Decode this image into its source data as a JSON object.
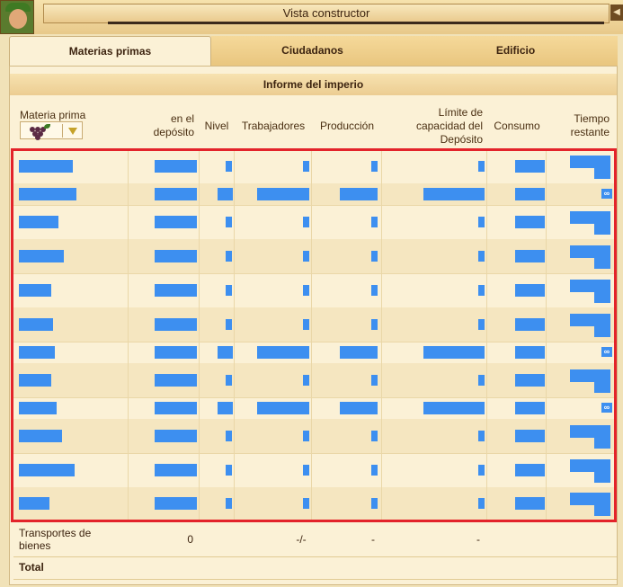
{
  "window": {
    "title": "Vista constructor",
    "close_icon": "close-arrow-icon"
  },
  "tabs": [
    {
      "label": "Materias primas",
      "active": true
    },
    {
      "label": "Ciudadanos",
      "active": false
    },
    {
      "label": "Edificio",
      "active": false
    }
  ],
  "report": {
    "title": "Informe del imperio"
  },
  "headers": {
    "resource": "Materia prima",
    "stock": "en el\ndepósito",
    "level": "Nivel",
    "workers": "Trabajadores",
    "production": "Producción",
    "capacity": "Límite de\ncapacidad del\nDepósito",
    "consumption": "Consumo",
    "time_left": "Tiempo\nrestante"
  },
  "filter": {
    "icon": "grapes-icon",
    "dropdown_icon": "triangle-down-icon"
  },
  "redacted_rows": 12,
  "footer": {
    "transport_label": "Transportes de\nbienes",
    "transport_stock": "0",
    "transport_workers": "-/-",
    "transport_production": "-",
    "transport_capacity": "-",
    "total_label": "Total"
  },
  "colors": {
    "redaction": "#3d8ff0",
    "highlight_box": "#e3232a"
  }
}
